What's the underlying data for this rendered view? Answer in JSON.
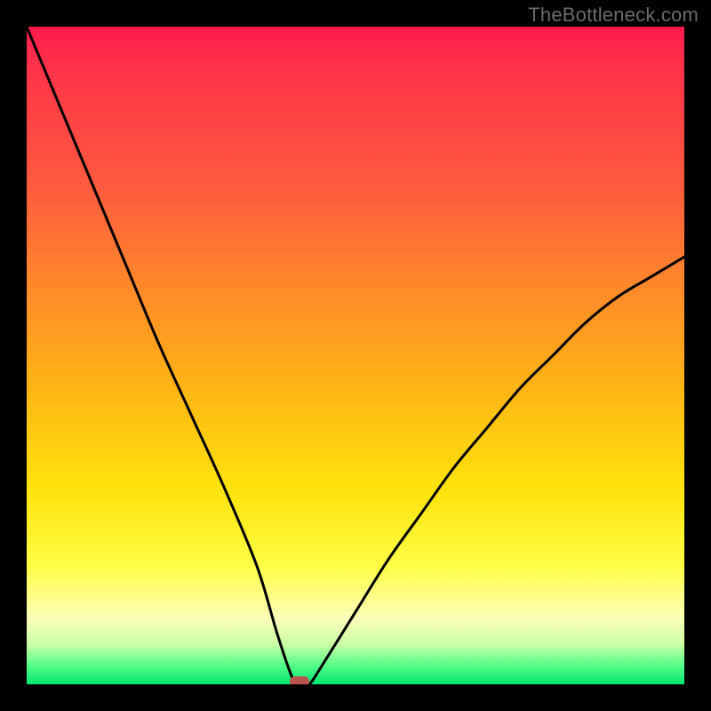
{
  "watermark": "TheBottleneck.com",
  "colors": {
    "frame": "#000000",
    "gradient_top": "#ff1a4d",
    "gradient_bottom": "#00e56f",
    "curve": "#000000",
    "marker": "#b9534d"
  },
  "chart_data": {
    "type": "line",
    "title": "",
    "xlabel": "",
    "ylabel": "",
    "xlim": [
      0,
      100
    ],
    "ylim": [
      0,
      100
    ],
    "x": [
      0,
      5,
      10,
      15,
      20,
      25,
      30,
      35,
      38,
      40,
      41,
      42,
      43,
      45,
      50,
      55,
      60,
      65,
      70,
      75,
      80,
      85,
      90,
      95,
      100
    ],
    "values": [
      100,
      88,
      76,
      64,
      52,
      41,
      30,
      18,
      8,
      2,
      0,
      0,
      0,
      3,
      11,
      19,
      26,
      33,
      39,
      45,
      50,
      55,
      59,
      62,
      65
    ],
    "marker": {
      "x": 41.5,
      "y": 0
    },
    "notes": "V-shaped bottleneck curve; minimum ≈0% near x≈41; left arm reaches ~100% at x=0; right arm rises to ~65% at x=100."
  }
}
